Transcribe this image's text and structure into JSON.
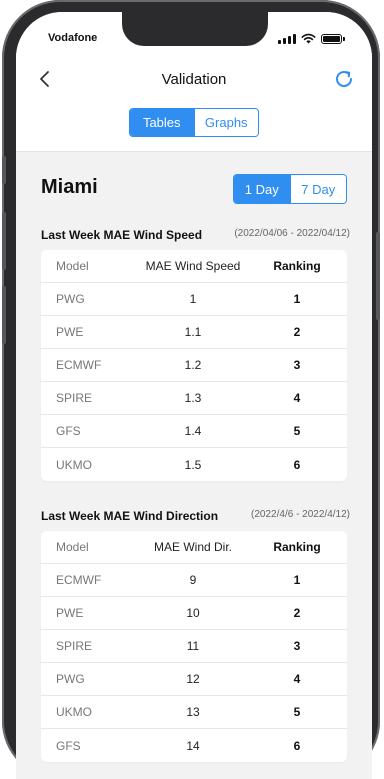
{
  "status_bar": {
    "carrier": "Vodafone"
  },
  "nav": {
    "title": "Validation",
    "back_icon": "chevron-left-icon",
    "refresh_icon": "refresh-icon",
    "accent_color": "#2f8ef0"
  },
  "view_tabs": {
    "items": [
      {
        "label": "Tables",
        "active": true
      },
      {
        "label": "Graphs",
        "active": false
      }
    ]
  },
  "location": {
    "name": "Miami"
  },
  "period_tabs": {
    "items": [
      {
        "label": "1 Day",
        "active": true
      },
      {
        "label": "7 Day",
        "active": false
      }
    ]
  },
  "wind_speed": {
    "title": "Last Week MAE Wind Speed",
    "date_range": "(2022/04/06 - 2022/04/12)",
    "columns": [
      "Model",
      "MAE Wind Speed",
      "Ranking"
    ],
    "rows": [
      {
        "model": "PWG",
        "value": "1",
        "rank": "1"
      },
      {
        "model": "PWE",
        "value": "1.1",
        "rank": "2"
      },
      {
        "model": "ECMWF",
        "value": "1.2",
        "rank": "3"
      },
      {
        "model": "SPIRE",
        "value": "1.3",
        "rank": "4"
      },
      {
        "model": "GFS",
        "value": "1.4",
        "rank": "5"
      },
      {
        "model": "UKMO",
        "value": "1.5",
        "rank": "6"
      }
    ]
  },
  "wind_direction": {
    "title": "Last Week MAE Wind Direction",
    "date_range": "(2022/4/6 - 2022/4/12)",
    "columns": [
      "Model",
      "MAE Wind Dir.",
      "Ranking"
    ],
    "rows": [
      {
        "model": "ECMWF",
        "value": "9",
        "rank": "1"
      },
      {
        "model": "PWE",
        "value": "10",
        "rank": "2"
      },
      {
        "model": "SPIRE",
        "value": "11",
        "rank": "3"
      },
      {
        "model": "PWG",
        "value": "12",
        "rank": "4"
      },
      {
        "model": "UKMO",
        "value": "13",
        "rank": "5"
      },
      {
        "model": "GFS",
        "value": "14",
        "rank": "6"
      }
    ]
  }
}
